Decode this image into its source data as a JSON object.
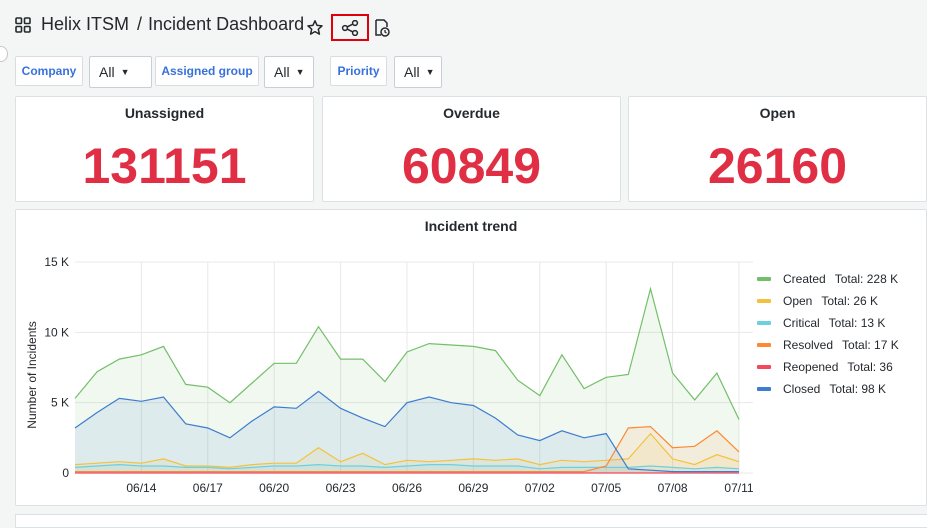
{
  "header": {
    "app": "Helix ITSM",
    "separator": "/",
    "page": "Incident Dashboard"
  },
  "filters": [
    {
      "label": "Company",
      "value": "All"
    },
    {
      "label": "Assigned group",
      "value": "All"
    },
    {
      "label": "Priority",
      "value": "All"
    }
  ],
  "stats": [
    {
      "title": "Unassigned",
      "value": "131151"
    },
    {
      "title": "Overdue",
      "value": "60849"
    },
    {
      "title": "Open",
      "value": "26160"
    }
  ],
  "colors": {
    "stat_value": "#e02f44",
    "created": "#73bf69",
    "open": "#f2c23c",
    "critical": "#6bd0e0",
    "resolved": "#ff8833",
    "reopened": "#f2495c",
    "closed": "#3d7ccf"
  },
  "chart_data": {
    "type": "area",
    "title": "Incident trend",
    "ylabel": "Number of Incidents",
    "xlabel": "",
    "ylim": [
      0,
      15000
    ],
    "yticks": [
      "0",
      "5 K",
      "10 K",
      "15 K"
    ],
    "xticks": [
      "06/14",
      "06/17",
      "06/20",
      "06/23",
      "06/26",
      "06/29",
      "07/02",
      "07/05",
      "07/08",
      "07/11"
    ],
    "x": [
      "06/11",
      "06/12",
      "06/13",
      "06/14",
      "06/15",
      "06/16",
      "06/17",
      "06/18",
      "06/19",
      "06/20",
      "06/21",
      "06/22",
      "06/23",
      "06/24",
      "06/25",
      "06/26",
      "06/27",
      "06/28",
      "06/29",
      "06/30",
      "07/01",
      "07/02",
      "07/03",
      "07/04",
      "07/05",
      "07/06",
      "07/07",
      "07/08",
      "07/09",
      "07/10",
      "07/11"
    ],
    "series": [
      {
        "name": "Created",
        "total": "Total: 228 K",
        "values": [
          5300,
          7200,
          8100,
          8400,
          9000,
          6300,
          6100,
          5000,
          6400,
          7800,
          7800,
          10400,
          8100,
          8100,
          6500,
          8600,
          9200,
          9100,
          9000,
          8700,
          6600,
          5500,
          8400,
          6000,
          6800,
          7000,
          13100,
          7100,
          5200,
          7100,
          3800
        ]
      },
      {
        "name": "Open",
        "total": "Total: 26 K",
        "values": [
          600,
          700,
          800,
          700,
          1000,
          500,
          500,
          400,
          600,
          700,
          700,
          1800,
          800,
          1400,
          600,
          900,
          800,
          900,
          1000,
          900,
          1000,
          600,
          900,
          800,
          900,
          1000,
          2800,
          1000,
          600,
          1300,
          800
        ]
      },
      {
        "name": "Critical",
        "total": "Total: 13 K",
        "values": [
          400,
          500,
          600,
          500,
          500,
          400,
          400,
          300,
          400,
          500,
          500,
          600,
          500,
          500,
          400,
          500,
          600,
          600,
          500,
          500,
          500,
          300,
          400,
          400,
          400,
          400,
          500,
          400,
          300,
          400,
          300
        ]
      },
      {
        "name": "Resolved",
        "total": "Total: 17 K",
        "values": [
          100,
          100,
          100,
          100,
          100,
          100,
          100,
          100,
          100,
          100,
          100,
          100,
          100,
          100,
          100,
          100,
          100,
          100,
          100,
          100,
          100,
          100,
          100,
          100,
          500,
          3200,
          3300,
          1800,
          1900,
          3000,
          1500
        ]
      },
      {
        "name": "Reopened",
        "total": "Total: 36",
        "values": [
          0,
          0,
          0,
          0,
          0,
          0,
          0,
          0,
          0,
          0,
          0,
          0,
          0,
          0,
          0,
          0,
          0,
          0,
          0,
          0,
          0,
          0,
          0,
          0,
          0,
          0,
          0,
          0,
          0,
          0,
          0
        ]
      },
      {
        "name": "Closed",
        "total": "Total: 98 K",
        "values": [
          3200,
          4300,
          5300,
          5100,
          5400,
          3500,
          3200,
          2500,
          3700,
          4700,
          4600,
          5800,
          4600,
          3900,
          3300,
          5000,
          5400,
          5000,
          4800,
          3900,
          2700,
          2300,
          3000,
          2500,
          2800,
          300,
          200,
          100,
          100,
          100,
          100
        ]
      }
    ],
    "grid": true,
    "legend_position": "right"
  }
}
